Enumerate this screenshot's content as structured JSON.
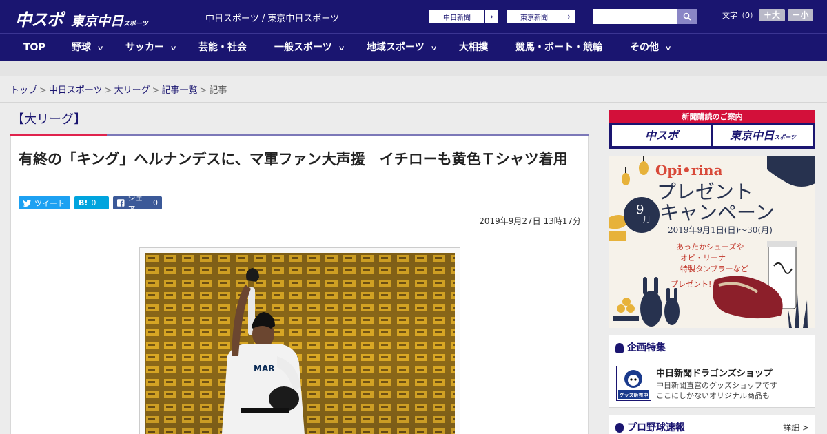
{
  "header": {
    "logo_main": "中スポ",
    "logo_sub": "東京中日",
    "logo_sub_small": "スポーツ",
    "site_names": "中日スポーツ / 東京中日スポーツ",
    "links": [
      {
        "label": "中日新聞"
      },
      {
        "label": "東京新聞"
      }
    ],
    "search_placeholder": "",
    "font_size_label": "文字（0）",
    "font_plus": "＋大",
    "font_minus": "－小"
  },
  "nav": {
    "items": [
      {
        "label": "TOP",
        "has_dropdown": false
      },
      {
        "label": "野球",
        "has_dropdown": true
      },
      {
        "label": "サッカー",
        "has_dropdown": true
      },
      {
        "label": "芸能・社会",
        "has_dropdown": false
      },
      {
        "label": "一般スポーツ",
        "has_dropdown": true
      },
      {
        "label": "地域スポーツ",
        "has_dropdown": true
      },
      {
        "label": "大相撲",
        "has_dropdown": false
      },
      {
        "label": "競馬・ボート・競輪",
        "has_dropdown": false
      },
      {
        "label": "その他",
        "has_dropdown": true
      }
    ],
    "chevron": "∨"
  },
  "breadcrumb": {
    "items": [
      "トップ",
      "中日スポーツ",
      "大リーグ",
      "記事一覧"
    ],
    "current": "記事",
    "separator": ">"
  },
  "article": {
    "category": "【大リーグ】",
    "headline": "有終の「キング」ヘルナンデスに、マ軍ファン大声援　イチローも黄色Ｔシャツ着用",
    "share": {
      "tweet_label": "ツイート",
      "hatena_count": "0",
      "facebook_label": "シェア",
      "facebook_count": "0"
    },
    "date": "2019年9月27日 13時17分"
  },
  "sidebar": {
    "subscription": {
      "heading": "新聞購読のご案内",
      "left": "中スポ",
      "right": "東京中日",
      "right_small": "スポーツ"
    },
    "ad": {
      "brand": "Opi•rina",
      "line1": "プレゼント",
      "line2": "キャンペーン",
      "month": "9",
      "month_unit": "月",
      "period": "2019年9月1日(日)〜30(月)",
      "text1": "あったかシューズや",
      "text2": "オピ・リーナ",
      "text3": "特製タンブラーなど",
      "text4": "プレゼント!!"
    },
    "feature": {
      "heading": "企画特集",
      "title": "中日新聞ドラゴンズショップ",
      "desc1": "中日新聞直営のグッズショップです",
      "desc2": "ここにしかないオリジナル商品も",
      "thumb_text": "グッズ販売中"
    },
    "scores": {
      "heading": "プロ野球速報",
      "more": "詳細 >"
    }
  },
  "colors": {
    "brand_navy": "#1a1570",
    "accent_red": "#e0234d",
    "twitter": "#1da1f2",
    "hatena": "#00a4de",
    "facebook": "#3b5998",
    "crowd_yellow": "#d9a520"
  }
}
